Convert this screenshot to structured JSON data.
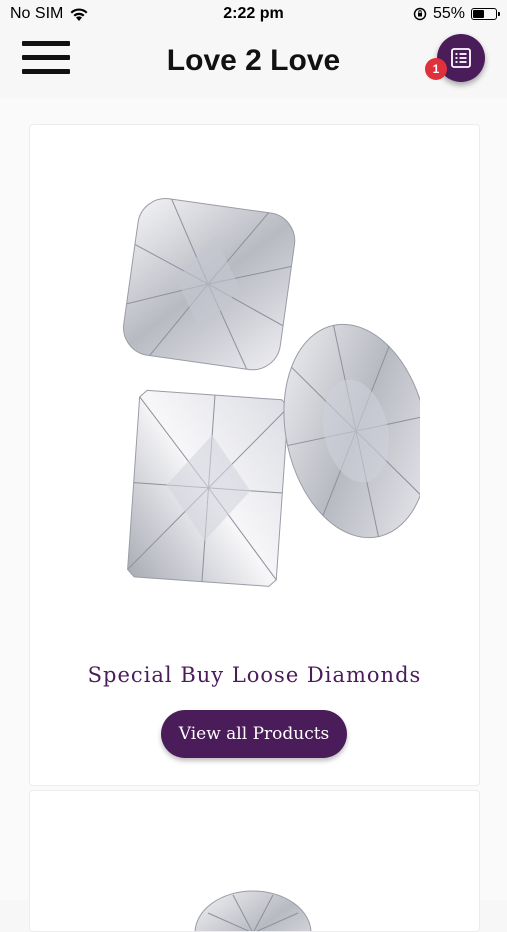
{
  "status_bar": {
    "carrier": "No SIM",
    "time": "2:22 pm",
    "battery_percent": "55%",
    "battery_level": 0.55
  },
  "header": {
    "title": "Love 2 Love",
    "notification_count": "1"
  },
  "products": [
    {
      "title": "Special Buy Loose Diamonds",
      "button_label": "View all Products"
    }
  ],
  "colors": {
    "brand": "#4b1c5a",
    "badge": "#e0303b"
  },
  "icons": [
    "menu-icon",
    "wifi-icon",
    "orientation-lock-icon",
    "battery-icon",
    "catalog-list-icon",
    "diamond-image"
  ]
}
